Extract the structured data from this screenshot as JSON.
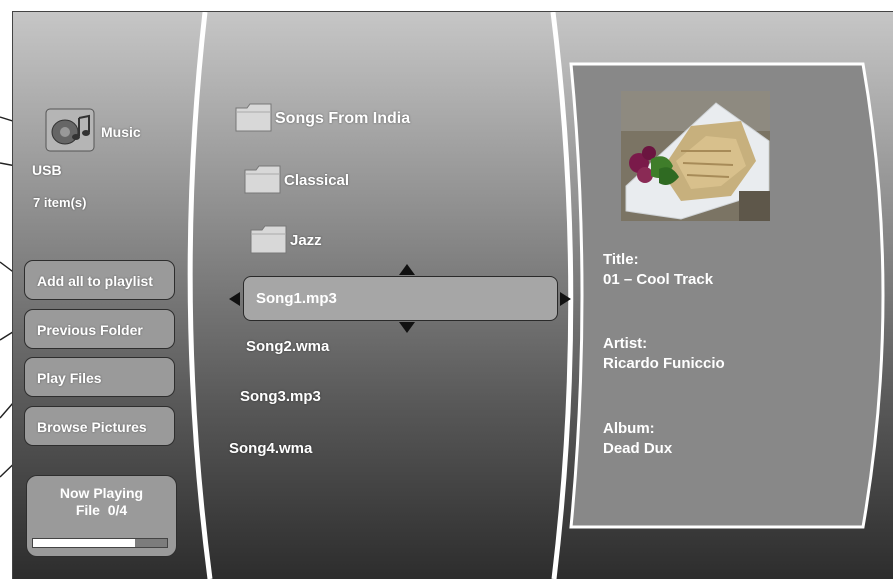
{
  "source": {
    "name": "Music",
    "device": "USB",
    "item_count": "7 item(s)",
    "icon": "music-speaker-icon"
  },
  "actions": [
    {
      "label": "Add all to playlist"
    },
    {
      "label": "Previous Folder"
    },
    {
      "label": "Play Files"
    },
    {
      "label": "Browse Pictures"
    }
  ],
  "now_playing": {
    "title": "Now Playing",
    "file": "File  0/4",
    "progress": 0.76
  },
  "folders": [
    {
      "name": "Songs From India",
      "icon": "folder-icon"
    },
    {
      "name": "Classical",
      "icon": "folder-icon"
    },
    {
      "name": "Jazz",
      "icon": "folder-icon"
    }
  ],
  "songs": [
    "Song1.mp3",
    "Song2.wma",
    "Song3.mp3",
    "Song4.wma"
  ],
  "selected_song": "Song1.mp3",
  "track": {
    "title_label": "Title:",
    "title": "01 – Cool Track",
    "artist_label": "Artist:",
    "artist": "Ricardo Funiccio",
    "album_label": "Album:",
    "album": "Dead Dux",
    "art": "food-plate-photo"
  },
  "colors": {
    "panel": "#9a9a9a",
    "info_panel": "#888888",
    "selected": "#a6a6a6",
    "text": "#ffffff"
  }
}
